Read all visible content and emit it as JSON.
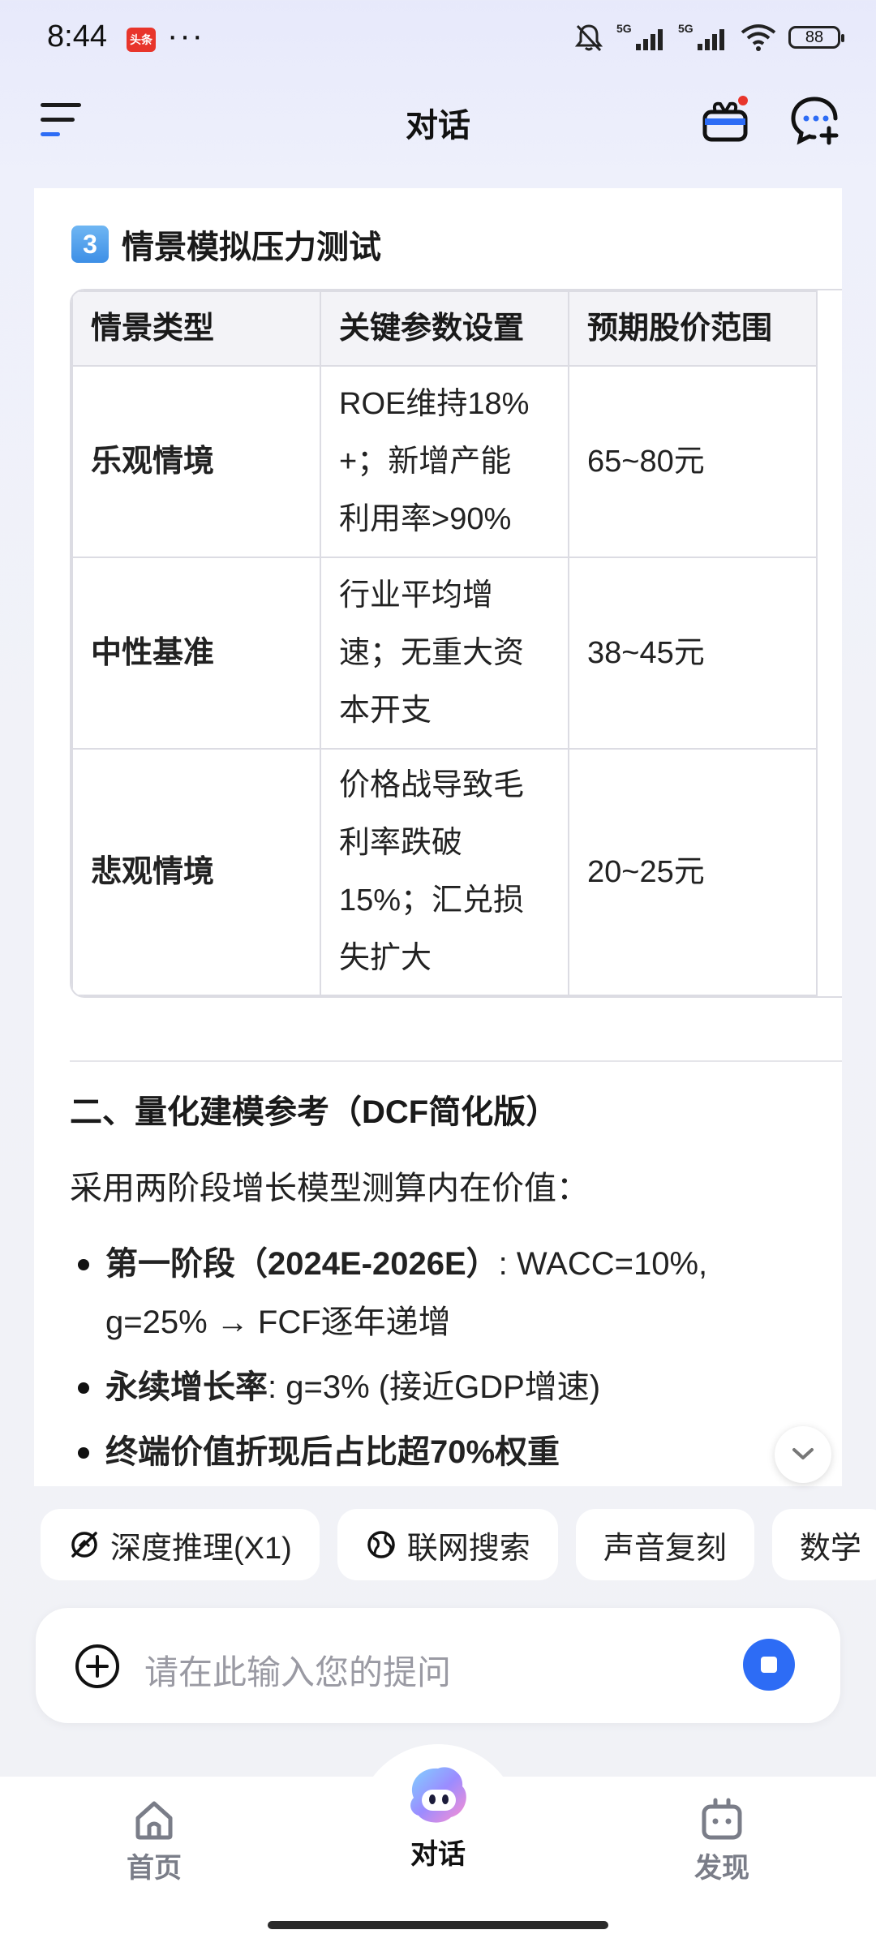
{
  "status_bar": {
    "time": "8:44",
    "app_badge": "头条",
    "more": "···",
    "battery": "88",
    "network": "5G"
  },
  "header": {
    "title": "对话"
  },
  "content": {
    "section_title": "情景模拟压力测试",
    "section_number": "3",
    "table": {
      "headers": [
        "情景类型",
        "关键参数设置",
        "预期股价范围"
      ],
      "rows": [
        {
          "type": "乐观情境",
          "params_lines": [
            "ROE维持18%",
            "+；新增产能",
            "利用率>90%"
          ],
          "range": "65~80元"
        },
        {
          "type": "中性基准",
          "params_lines": [
            "行业平均增",
            "速；无重大资",
            "本开支"
          ],
          "range": "38~45元"
        },
        {
          "type": "悲观情境",
          "params_lines": [
            "价格战导致毛",
            "利率跌破",
            "15%；汇兑损",
            "失扩大"
          ],
          "range": "20~25元"
        }
      ]
    },
    "h2": "二、量化建模参考（DCF简化版）",
    "paragraph": "采用两阶段增长模型测算内在价值：",
    "bullets": [
      {
        "bold": "第一阶段（2024E-2026E）",
        "rest": ": WACC=10%,",
        "line2": "g=25% → FCF逐年递增"
      },
      {
        "bold": "永续增长率",
        "rest": ": g=3% (接近GDP增速)",
        "line2": ""
      },
      {
        "bold": "终端价值折现后占比超70%权重",
        "rest": "",
        "line2": ""
      }
    ]
  },
  "chips": [
    "深度推理(X1)",
    "联网搜索",
    "声音复刻",
    "数学"
  ],
  "input": {
    "placeholder": "请在此输入您的提问"
  },
  "bottom_nav": {
    "home": "首页",
    "chat": "对话",
    "discover": "发现"
  }
}
